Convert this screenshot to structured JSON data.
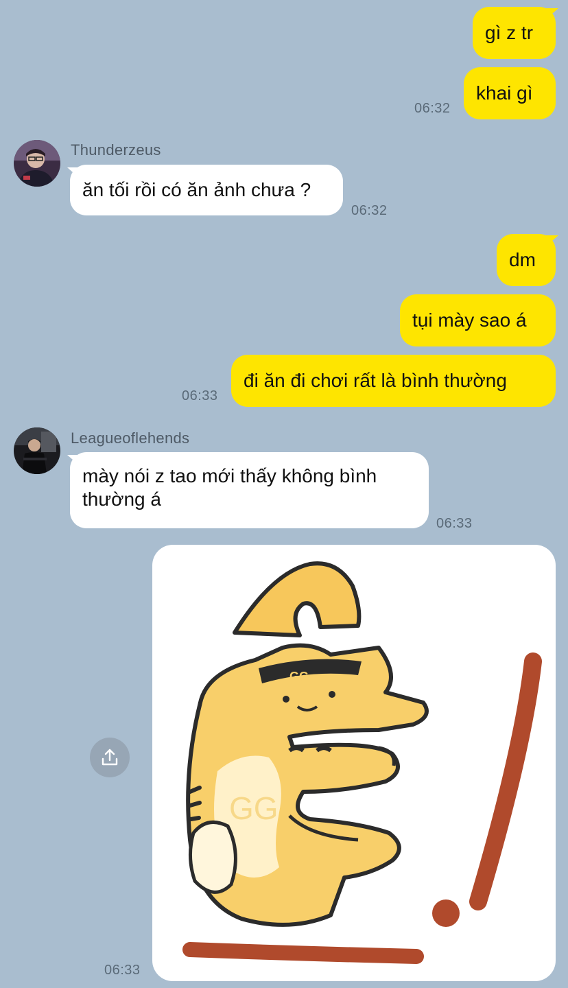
{
  "messages": {
    "m1": "gì z tr",
    "m2": "khai gì",
    "t1": "06:32",
    "sender1": "Thunderzeus",
    "m3": "ăn tối rồi có ăn ảnh chưa ?",
    "t2": "06:32",
    "m4": "dm",
    "m5": "tụi mày sao á",
    "m6": "đi ăn đi chơi rất là bình thường",
    "t3": "06:33",
    "sender2": "Leagueoflehends",
    "m7_line1": "mày nói z tao mới thấy không bình",
    "m7_line2": "thường á",
    "t4": "06:33",
    "t5": "06:33"
  },
  "icons": {
    "share": "share-upload-icon",
    "sticker": "cat-sticker"
  },
  "colors": {
    "background": "#a9bdcf",
    "outgoing_bubble": "#fee500",
    "incoming_bubble": "#ffffff",
    "timestamp": "#5a6a78"
  }
}
